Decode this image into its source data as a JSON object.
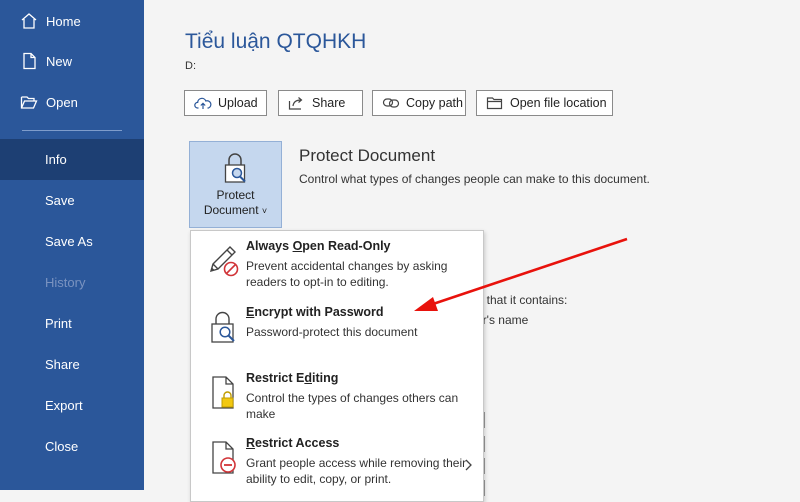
{
  "sidebar": {
    "items": [
      {
        "label": "Home",
        "icon": "home-icon"
      },
      {
        "label": "New",
        "icon": "new-document-icon"
      },
      {
        "label": "Open",
        "icon": "open-folder-icon"
      },
      {
        "label": "Info"
      },
      {
        "label": "Save"
      },
      {
        "label": "Save As"
      },
      {
        "label": "History"
      },
      {
        "label": "Print"
      },
      {
        "label": "Share"
      },
      {
        "label": "Export"
      },
      {
        "label": "Close"
      }
    ],
    "active": "Info",
    "disabled": "History"
  },
  "document": {
    "title": "Tiểu luận QTQHKH",
    "path": "D:"
  },
  "toolbar": {
    "upload": "Upload",
    "share": "Share",
    "copy_path": "Copy path",
    "open_location": "Open file location"
  },
  "protect": {
    "tile_line1": "Protect",
    "tile_line2": "Document",
    "tile_caret": "˅",
    "heading": "Protect Document",
    "description": "Control what types of changes people can make to this document."
  },
  "background_text": {
    "inspect_partial": "are that it contains:",
    "author_partial": "thor's name"
  },
  "menu": {
    "items": [
      {
        "title": "Always Open Read-Only",
        "mnemonic": "O",
        "desc": "Prevent accidental changes by asking readers to opt-in to editing."
      },
      {
        "title": "Encrypt with Password",
        "mnemonic": "E",
        "desc": "Password-protect this document"
      },
      {
        "title": "Restrict Editing",
        "mnemonic": "d",
        "desc": "Control the types of changes others can make"
      },
      {
        "title": "Restrict Access",
        "mnemonic": "R",
        "desc": "Grant people access while removing their ability to edit, copy, or print."
      }
    ]
  },
  "colors": {
    "sidebar": "#2b579a",
    "sidebar_active": "#1d3f73",
    "title": "#2b579a",
    "annotation_arrow": "#e8120c"
  }
}
